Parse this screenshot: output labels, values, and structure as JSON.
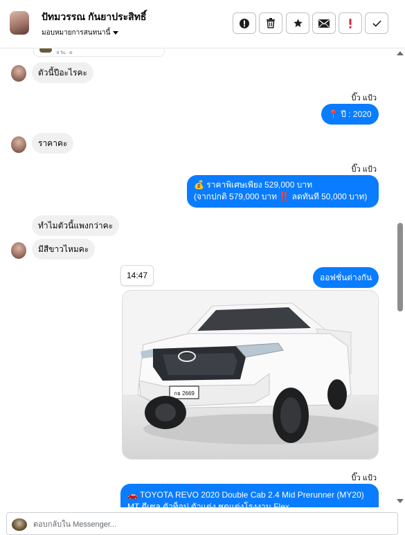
{
  "header": {
    "contact_name": "ปัทมวรรณ กันยาประสิทธิ์",
    "assign_label": "มอบหมายการสนทนานี้",
    "actions": [
      "info",
      "delete",
      "star",
      "mail",
      "mark-urgent",
      "mark-done"
    ]
  },
  "messages": {
    "top_card_meta": "6 วัน · ⊘",
    "m1": "ตัวนี้ปีอะไรคะ",
    "m2_sender": "บิ๊ว แป้ว",
    "m2": "📍 ปี : 2020",
    "m3": "ราคาคะ",
    "m4_sender": "บิ๊ว แป้ว",
    "m4_line1": "💰 ราคาพิเศษเพียง 529,000 บาท",
    "m4_line2": "(จากปกติ 579,000 บาท ‼️ ลดทันที 50,000 บาท)",
    "m5": "ทำไมตัวนี้แพงกว่าคะ",
    "m6": "มีสีขาวไหมคะ",
    "timestamp": "14:47",
    "m7": "ออฟชั่นต่างกัน",
    "car_plate": "กธ 2669",
    "m8_sender": "บิ๊ว แป้ว",
    "m8_line1": "🚗 TOYOTA REVO 2020 Double Cab 2.4 Mid Prerunner (MY20)",
    "m8_line2": "MT ดีเซล ตัวท็อป ตัวแต่ง ชุดแต่งโรงงาน Flex"
  },
  "reply": {
    "placeholder": "ตอบกลับใน Messenger..."
  },
  "colors": {
    "outgoing_bubble": "#0a7cff",
    "incoming_bubble": "#f0f0f0",
    "urgent": "#e41e3f"
  }
}
